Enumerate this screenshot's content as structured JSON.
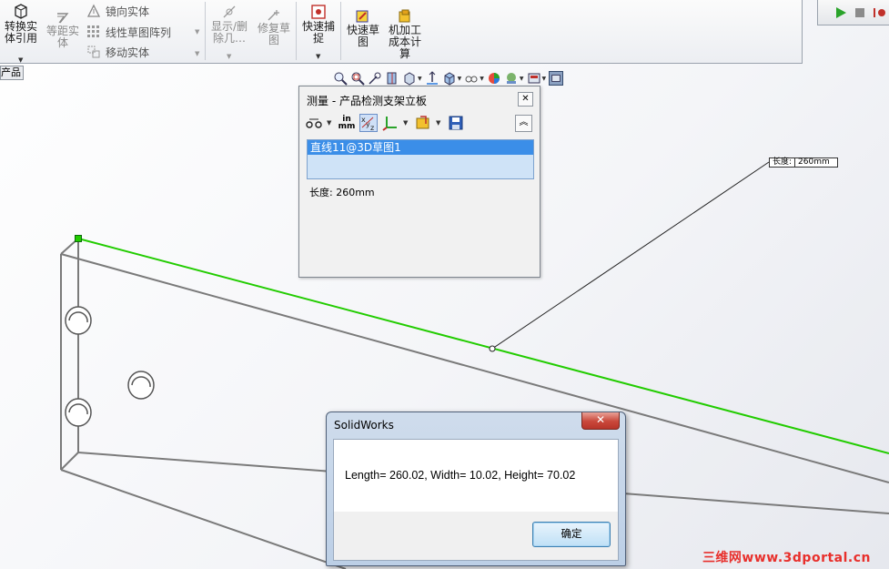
{
  "ribbon": {
    "convert_entities": "转换实\n体引用",
    "offset_entities": "等距实\n体",
    "mirror_entities": "镜向实体",
    "linear_pattern": "线性草图阵列",
    "move_entities": "移动实体",
    "show_delete": "显示/删\n除几…",
    "repair_sketch": "修复草\n图",
    "quick_snaps": "快速捕\n捉",
    "rapid_sketch": "快速草\n图",
    "costing": "机加工\n成本计\n算"
  },
  "tab_stub": "产品",
  "measure": {
    "title": "测量 - 产品检测支架立板",
    "units_label": "in\nmm",
    "selection": "直线11@3D草图1",
    "result": "长度: 260mm"
  },
  "callout": {
    "label": "长度:",
    "value": "260mm"
  },
  "msgbox": {
    "title": "SolidWorks",
    "message": "Length= 260.02, Width= 10.02, Height= 70.02",
    "ok": "确定"
  },
  "watermark": "三维网www.3dportal.cn",
  "colors": {
    "selected_edge": "#22cc00",
    "accent": "#3b8ee8",
    "watermark": "#e8302c"
  }
}
